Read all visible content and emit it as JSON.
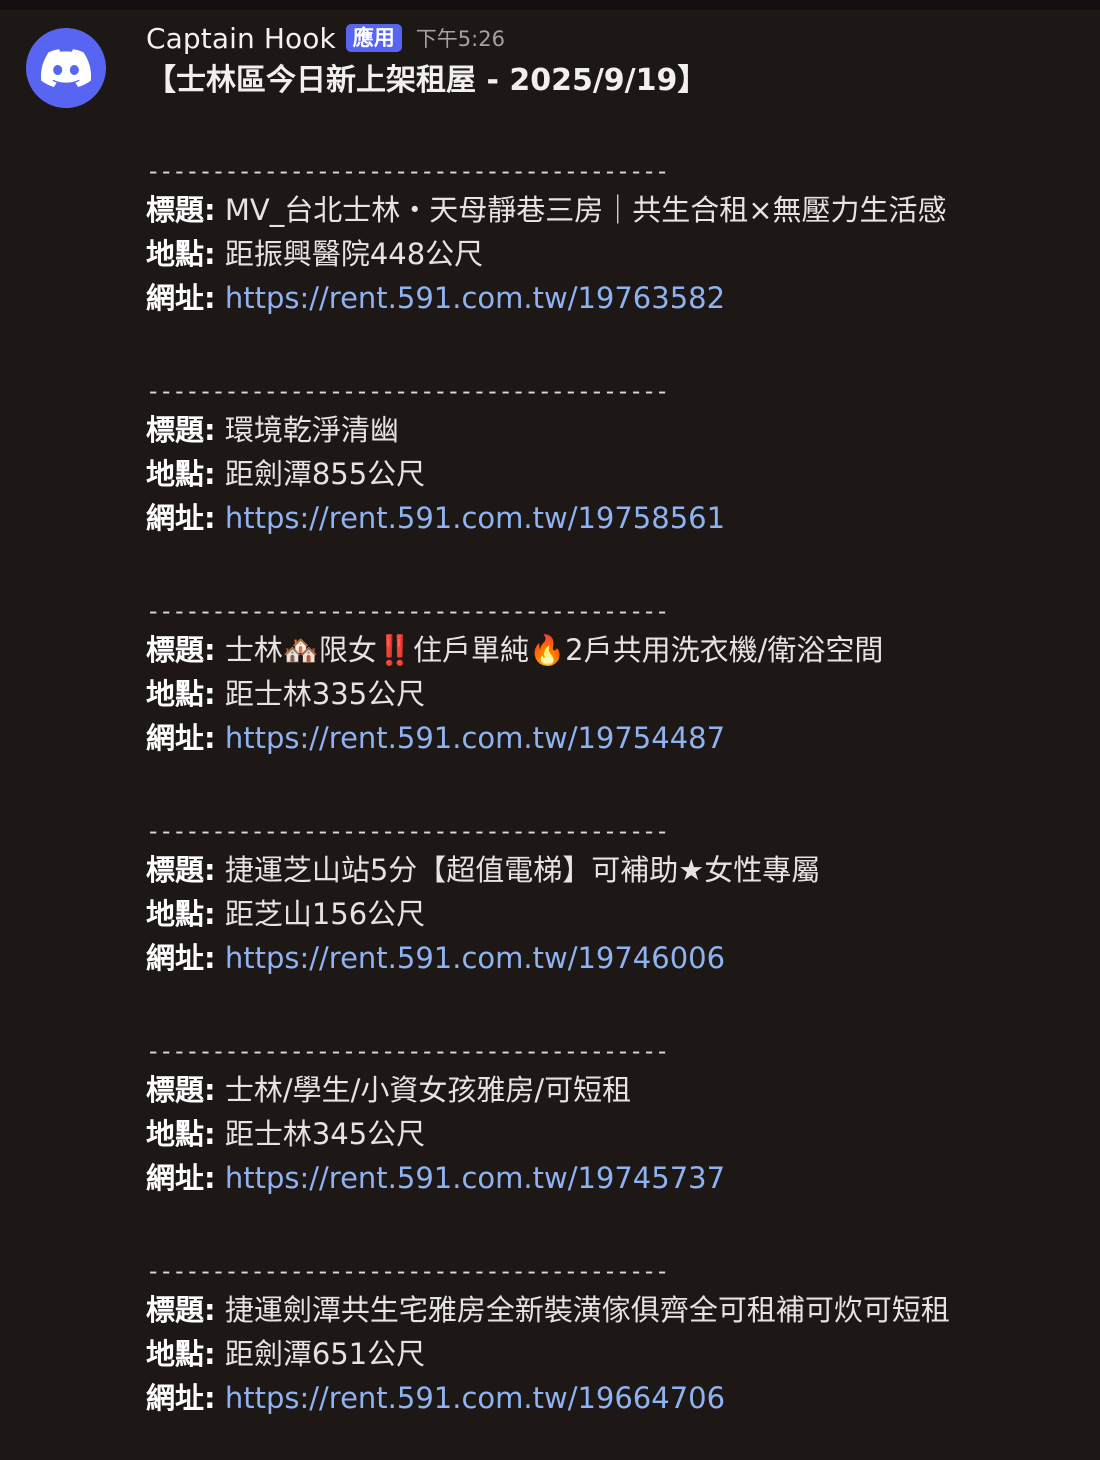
{
  "message": {
    "author": "Captain Hook",
    "app_badge": "應用",
    "timestamp": "下午5:26",
    "headline": "【士林區今日新上架租屋 - 2025/9/19】",
    "divider": "----------------------------------------",
    "labels": {
      "title": "標題:",
      "location": "地點:",
      "url": "網址:"
    },
    "listings": [
      {
        "title": "MV_台北士林・天母靜巷三房｜共生合租×無壓力生活感",
        "location": "距振興醫院448公尺",
        "url": "https://rent.591.com.tw/19763582"
      },
      {
        "title": "環境乾淨清幽",
        "location": "距劍潭855公尺",
        "url": "https://rent.591.com.tw/19758561"
      },
      {
        "title": "士林🏘️限女‼️住戶單純🔥2戶共用洗衣機/衛浴空間",
        "location": "距士林335公尺",
        "url": "https://rent.591.com.tw/19754487"
      },
      {
        "title": "捷運芝山站5分【超值電梯】可補助★女性專屬",
        "location": "距芝山156公尺",
        "url": "https://rent.591.com.tw/19746006"
      },
      {
        "title": "士林/學生/小資女孩雅房/可短租",
        "location": "距士林345公尺",
        "url": "https://rent.591.com.tw/19745737"
      },
      {
        "title": "捷運劍潭共生宅雅房全新裝潢傢俱齊全可租補可炊可短租",
        "location": "距劍潭651公尺",
        "url": "https://rent.591.com.tw/19664706"
      }
    ]
  },
  "colors": {
    "background": "#1d1716",
    "brand": "#5865f2",
    "link": "#8fb3f0",
    "muted": "#a7a1a0"
  },
  "icons": {
    "avatar": "discord-logo-icon"
  }
}
